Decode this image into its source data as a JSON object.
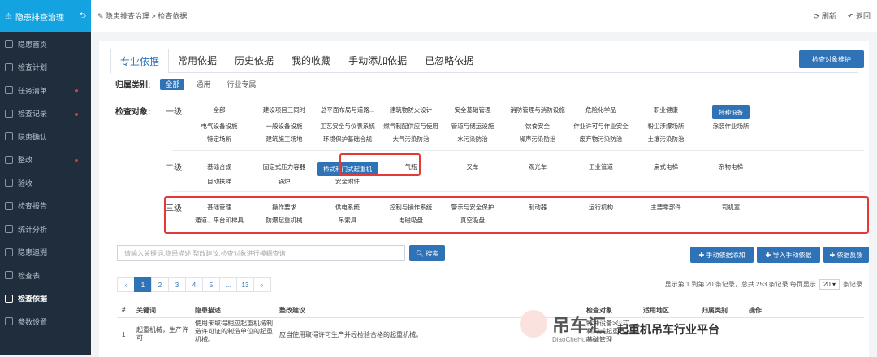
{
  "sidebar": {
    "title": "隐患排查治理",
    "items": [
      {
        "label": "隐患首页",
        "dot": false
      },
      {
        "label": "检查计划",
        "dot": false
      },
      {
        "label": "任务清单",
        "dot": true
      },
      {
        "label": "检查记录",
        "dot": true
      },
      {
        "label": "隐患确认",
        "dot": false
      },
      {
        "label": "整改",
        "dot": true
      },
      {
        "label": "验收",
        "dot": false
      },
      {
        "label": "检查报告",
        "dot": false
      },
      {
        "label": "统计分析",
        "dot": false
      },
      {
        "label": "隐患追溯",
        "dot": false
      },
      {
        "label": "检查表",
        "dot": false
      },
      {
        "label": "检查依据",
        "dot": false,
        "active": true
      },
      {
        "label": "参数设置",
        "dot": false
      }
    ]
  },
  "topbar": {
    "breadcrumb": "✎ 隐患排查治理  >  检查依据",
    "refresh": "刷新",
    "back": "返回"
  },
  "tabs": [
    "专业依据",
    "常用依据",
    "历史依据",
    "我的收藏",
    "手动添加依据",
    "已忽略依据"
  ],
  "maintain_button": "检查对象维护",
  "category": {
    "label": "归属类别:",
    "chips": [
      "全部",
      "通用",
      "行业专属"
    ]
  },
  "object_label": "检查对象:",
  "levels": {
    "l1": "一级",
    "l2": "二级",
    "l3": "三级"
  },
  "level1": [
    [
      "全部",
      "建设项目三同时",
      "总平面布局与道路...",
      "建筑物防火设计",
      "安全基础管理",
      "消防管理与消防设施",
      "危险化学品",
      "职业健康",
      "特种设备"
    ],
    [
      "电气设备设施",
      "一般设备设施",
      "工艺安全与仪表系统",
      "燃气制配供应与使用",
      "管道与储运设施",
      "饮食安全",
      "作业许可与作业安全",
      "粉尘涉爆场所",
      "涂装作业场所"
    ],
    [
      "特定场所",
      "建筑施工场地",
      "环境保护基础合规",
      "大气污染防治",
      "水污染防治",
      "噪声污染防治",
      "废弃物污染防治",
      "土壤污染防治"
    ]
  ],
  "level2": [
    [
      "基础合规",
      "固定式压力容器",
      "桥式和门式起重机",
      "气瓶",
      "叉车",
      "观光车",
      "工业管道",
      "扁式电梯",
      "杂物电梯"
    ],
    [
      "自动扶梯",
      "锅炉",
      "安全附件"
    ]
  ],
  "level3": [
    [
      "基础管理",
      "操作要求",
      "供电系统",
      "控制与操作系统",
      "警示与安全保护",
      "制动器",
      "运行机构",
      "主要零部件",
      "司机室"
    ],
    [
      "通道、平台和梯具",
      "防爆起重机械",
      "吊索具",
      "电磁吸盘",
      "真空吸盘"
    ]
  ],
  "search": {
    "placeholder": "请输入关键词,隐患描述,整改建议,检查对象进行模糊查询",
    "button": "搜索"
  },
  "actions": [
    "手动依据添加",
    "导入手动依据",
    "依据反馈"
  ],
  "pager": {
    "pages": [
      "‹",
      "1",
      "2",
      "3",
      "4",
      "5",
      "...",
      "13",
      "›"
    ],
    "info": "显示第 1 到第 20 条记录，总共 253 条记录 每页显示",
    "size": "20",
    "suffix": "条记录"
  },
  "table": {
    "headers": [
      "#",
      "关键词",
      "隐患描述",
      "整改建议",
      "检查对象",
      "适用地区",
      "归属类别",
      "操作"
    ],
    "row": {
      "num": "1",
      "keyword": "起重机械，生产许可",
      "desc": "使用未取得相应起重机械制造许可证的制造单位的起重机械。",
      "advice": "应当使用取得许可生产并经检验合格的起重机械。",
      "object": "特种设备>桥式和门式起重机>基础管理"
    }
  },
  "watermark": {
    "brand": "吊车汇",
    "url": "DiaoCheHui.com",
    "slogan": "起重机吊车行业平台"
  }
}
